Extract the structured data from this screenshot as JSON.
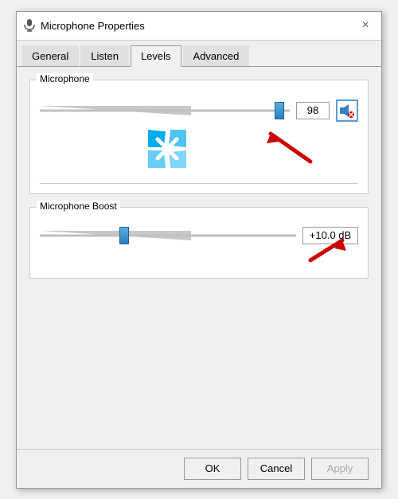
{
  "window": {
    "title": "Microphone Properties",
    "close_label": "×"
  },
  "tabs": [
    {
      "label": "General",
      "active": false
    },
    {
      "label": "Listen",
      "active": false
    },
    {
      "label": "Levels",
      "active": true
    },
    {
      "label": "Advanced",
      "active": false
    }
  ],
  "microphone_section": {
    "label": "Microphone",
    "slider_value": "98",
    "slider_position_pct": 96
  },
  "boost_section": {
    "label": "Microphone Boost",
    "boost_value": "+10.0 dB",
    "slider_position_pct": 33
  },
  "footer": {
    "ok_label": "OK",
    "cancel_label": "Cancel",
    "apply_label": "Apply"
  },
  "icons": {
    "mic": "🎤",
    "speaker_muted": "🔇"
  }
}
